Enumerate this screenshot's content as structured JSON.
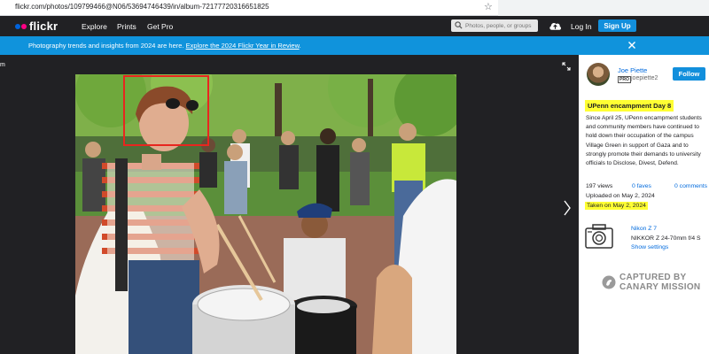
{
  "browser": {
    "url": "flickr.com/photos/109799466@N06/53694746439/in/album-72177720316651825"
  },
  "nav": {
    "logo": "flickr",
    "links": [
      "Explore",
      "Prints",
      "Get Pro"
    ],
    "search_placeholder": "Photos, people, or groups",
    "login": "Log In",
    "signup": "Sign Up"
  },
  "banner": {
    "text": "Photography trends and insights from 2024 are here. ",
    "link": "Explore the 2024 Flickr Year in Review",
    "period": "."
  },
  "photo": {
    "edge_label": "m"
  },
  "owner": {
    "name": "Joe Piette",
    "badge": "PRO",
    "handle": "joepiette2",
    "follow": "Follow"
  },
  "details": {
    "title": "UPenn encampment Day 8",
    "description": "Since April 25, UPenn encampment students and community members have continued to hold down their occupation of the campus Village Green in support of Gaza and to strongly promote their demands to university officials to Disclose, Divest, Defend.",
    "views": "197 views",
    "faves": "0 faves",
    "comments": "0 comments",
    "uploaded": "Uploaded on May 2, 2024",
    "taken": "Taken on May 2, 2024"
  },
  "camera": {
    "model": "Nikon Z 7",
    "lens": "NIKKOR Z 24-70mm f/4 S",
    "settings": "Show settings"
  },
  "watermark": {
    "line1": "CAPTURED BY",
    "line2": "CANARY MISSION"
  }
}
